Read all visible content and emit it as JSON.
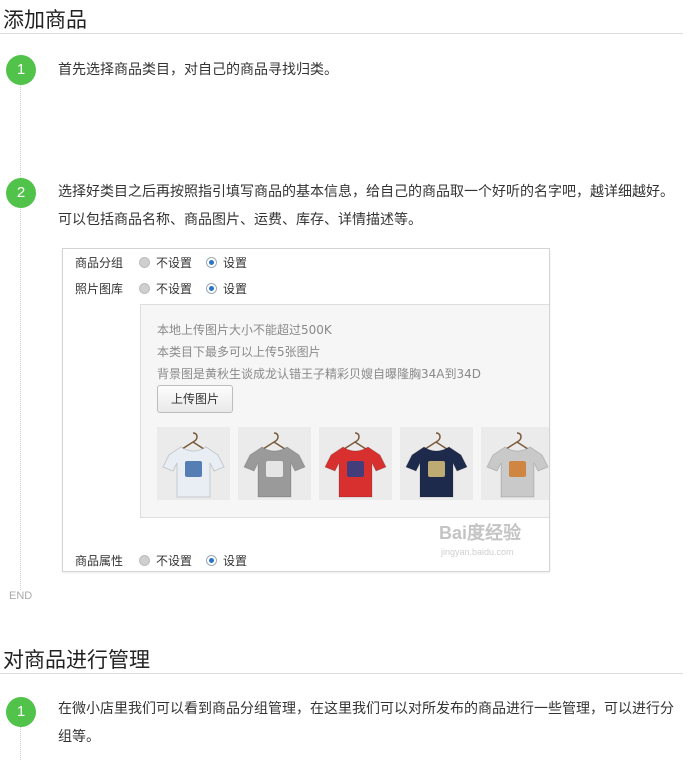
{
  "section1": {
    "title": "添加商品",
    "steps": [
      {
        "number": "1",
        "text": "首先选择商品类目，对自己的商品寻找归类。"
      },
      {
        "number": "2",
        "text": "选择好类目之后再按照指引填写商品的基本信息，给自己的商品取一个好听的名字吧，越详细越好。可以包括商品名称、商品图片、运费、库存、详情描述等。"
      }
    ],
    "end_label": "END"
  },
  "screenshot": {
    "rows": [
      {
        "label": "商品分组",
        "option_off": "不设置",
        "option_on": "设置"
      },
      {
        "label": "照片图库",
        "option_off": "不设置",
        "option_on": "设置"
      },
      {
        "label": "商品属性",
        "option_off": "不设置",
        "option_on": "设置"
      }
    ],
    "hints": [
      "本地上传图片大小不能超过500K",
      "本类目下最多可以上传5张图片",
      "背景图是黄秋生谈成龙认错王子精彩贝嫂自曝隆胸34A到34D"
    ],
    "upload_button": "上传图片",
    "thumbnails": [
      {
        "name": "white-patterned-tshirt",
        "shirt": "#e8eef4",
        "print": "#3a6aa8"
      },
      {
        "name": "gray-graphic-tshirt",
        "shirt": "#9a9a9a",
        "print": "#f2f2f2"
      },
      {
        "name": "red-graphic-tshirt",
        "shirt": "#d8302e",
        "print": "#2a3f8a"
      },
      {
        "name": "navy-dotted-tshirt",
        "shirt": "#1e2a4c",
        "print": "#d9c27a"
      },
      {
        "name": "gray-print-tshirt",
        "shirt": "#c9c9c9",
        "print": "#d07a2a"
      }
    ],
    "watermark": "Bai度经验",
    "watermark_sub": "jingyan.baidu.com"
  },
  "section2": {
    "title": "对商品进行管理",
    "steps": [
      {
        "number": "1",
        "text": "在微小店里我们可以看到商品分组管理，在这里我们可以对所发布的商品进行一些管理，可以进行分组等。"
      }
    ]
  },
  "colors": {
    "accent": "#52c34a",
    "radio_selected": "#2b74c9"
  }
}
